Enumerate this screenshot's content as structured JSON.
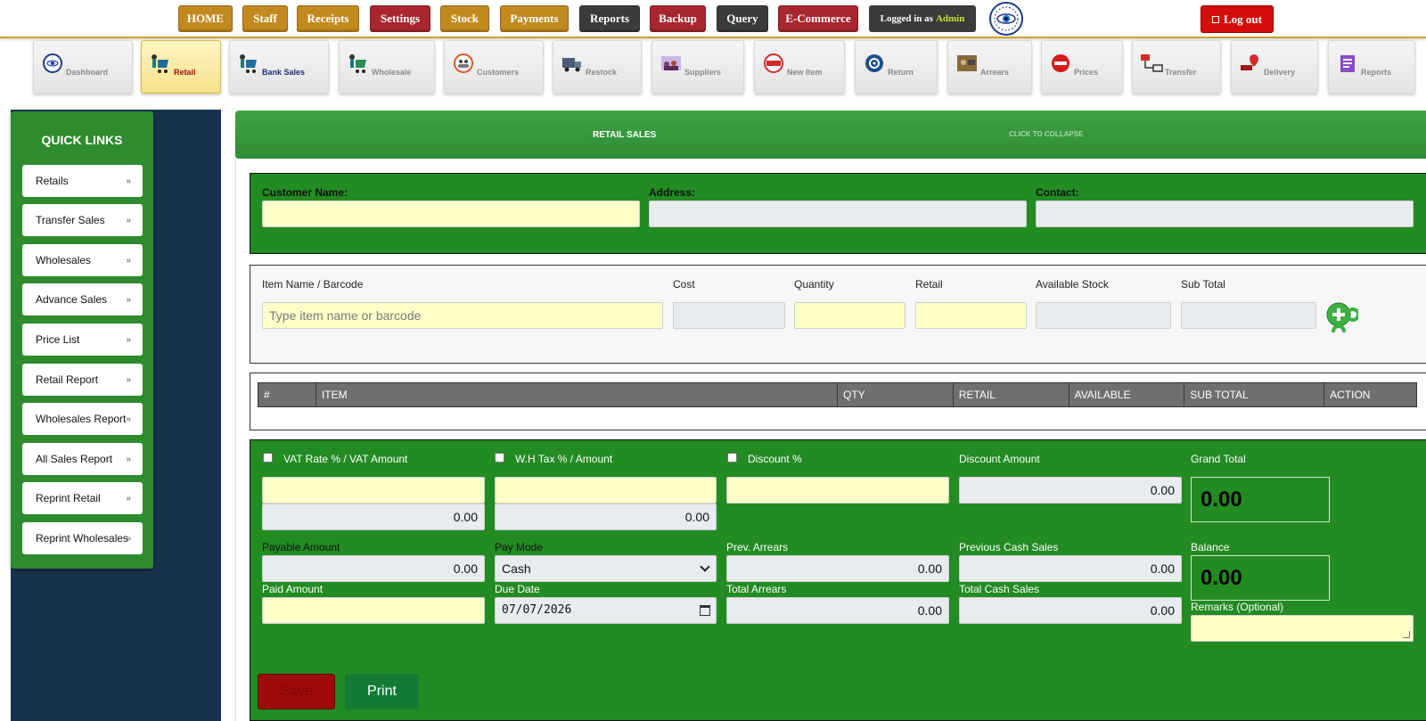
{
  "nav": {
    "home": "HOME",
    "staff": "Staff",
    "receipts": "Receipts",
    "settings": "Settings",
    "stock": "Stock",
    "payments": "Payments",
    "reports": "Reports",
    "backup": "Backup",
    "query": "Query",
    "ecommerce": "E-Commerce",
    "logged_prefix": "Logged in as",
    "logged_user": "Admin",
    "logout": "Log out"
  },
  "tiles": [
    "Dashboard",
    "Retail",
    "Bank Sales",
    "Wholesale",
    "Customers",
    "Restock",
    "Suppliers",
    "New Item",
    "Return",
    "Arrears",
    "Prices",
    "Transfer",
    "Delivery",
    "Reports"
  ],
  "quick_links": {
    "title": "QUICK LINKS",
    "items": [
      "Retails",
      "Transfer Sales",
      "Wholesales",
      "Advance Sales",
      "Price List",
      "Retail Report",
      "Wholesales Report",
      "All Sales Report",
      "Reprint Retail",
      "Reprint Wholesales"
    ]
  },
  "panel": {
    "title": "RETAIL SALES",
    "collapse": "CLICK TO COLLAPSE"
  },
  "customer": {
    "name_label": "Customer Name:",
    "address_label": "Address:",
    "contact_label": "Contact:"
  },
  "item": {
    "name_label": "Item Name / Barcode",
    "name_placeholder": "Type item name or barcode",
    "cost_label": "Cost",
    "qty_label": "Quantity",
    "retail_label": "Retail",
    "stock_label": "Available Stock",
    "subtotal_label": "Sub Total"
  },
  "table": {
    "headers": [
      "#",
      "ITEM",
      "QTY",
      "RETAIL",
      "AVAILABLE",
      "SUB TOTAL",
      "ACTION"
    ]
  },
  "totals": {
    "vat_label": "VAT Rate % / VAT Amount",
    "vat_amount": "0.00",
    "wht_label": "W.H Tax % / Amount",
    "wht_amount": "0.00",
    "discount_pct_label": "Discount %",
    "discount_amount_label": "Discount Amount",
    "discount_amount": "0.00",
    "grand_total_label": "Grand Total",
    "grand_total": "0.00",
    "payable_label": "Payable Amount",
    "payable": "0.00",
    "paymode_label": "Pay Mode",
    "paymode": "Cash",
    "prev_arrears_label": "Prev. Arrears",
    "prev_arrears": "0.00",
    "prev_cash_label": "Previous Cash Sales",
    "prev_cash": "0.00",
    "balance_label": "Balance",
    "balance": "0.00",
    "paid_label": "Paid Amount",
    "due_label": "Due Date",
    "due_date": "07/07/2026",
    "total_arrears_label": "Total Arrears",
    "total_arrears": "0.00",
    "total_cash_label": "Total Cash Sales",
    "total_cash": "0.00",
    "remarks_label": "Remarks (Optional)"
  },
  "buttons": {
    "save": "Save",
    "print": "Print"
  },
  "colors": {
    "green": "#228b22",
    "gold": "#c28a1e",
    "red": "#a8262e",
    "sidebar": "#17324f",
    "input_yellow": "#ffffc8"
  }
}
